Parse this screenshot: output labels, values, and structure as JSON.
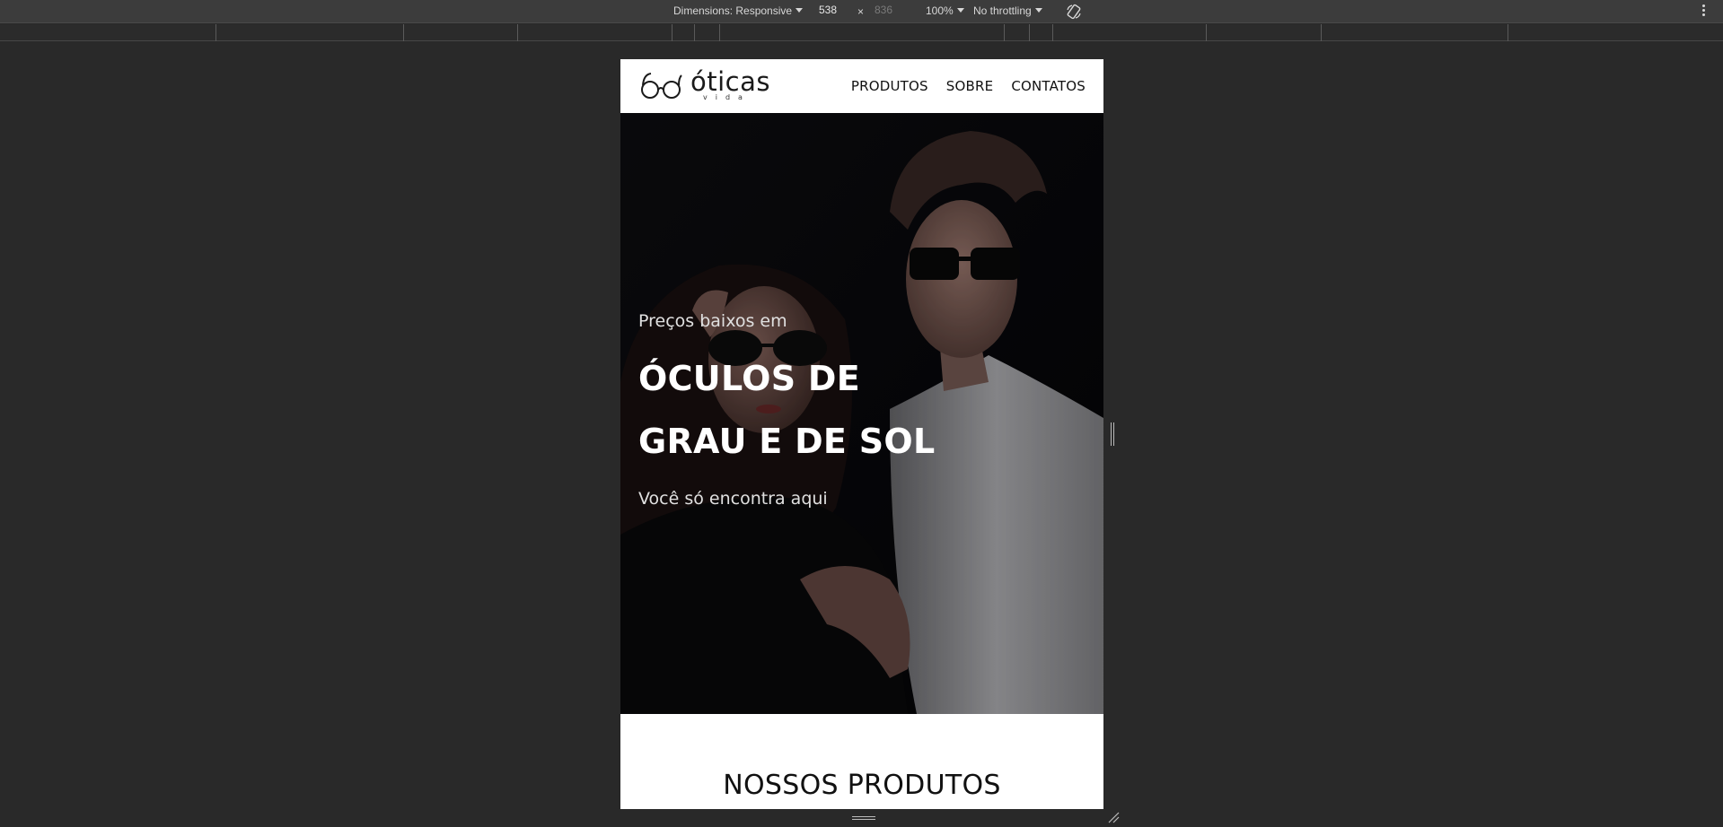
{
  "devtools": {
    "dimensions_label": "Dimensions: Responsive",
    "width_value": "538",
    "times": "×",
    "height_value": "836",
    "zoom": "100%",
    "throttling": "No throttling"
  },
  "site": {
    "logo": {
      "word": "óticas",
      "sub": "vida"
    },
    "nav": [
      "PRODUTOS",
      "SOBRE",
      "CONTATOS"
    ],
    "hero": {
      "pre": "Preços baixos em",
      "title_line1": "ÓCULOS DE",
      "title_line2": "GRAU E DE SOL",
      "post": "Você só encontra aqui"
    },
    "products_heading": "NOSSOS PRODUTOS"
  }
}
